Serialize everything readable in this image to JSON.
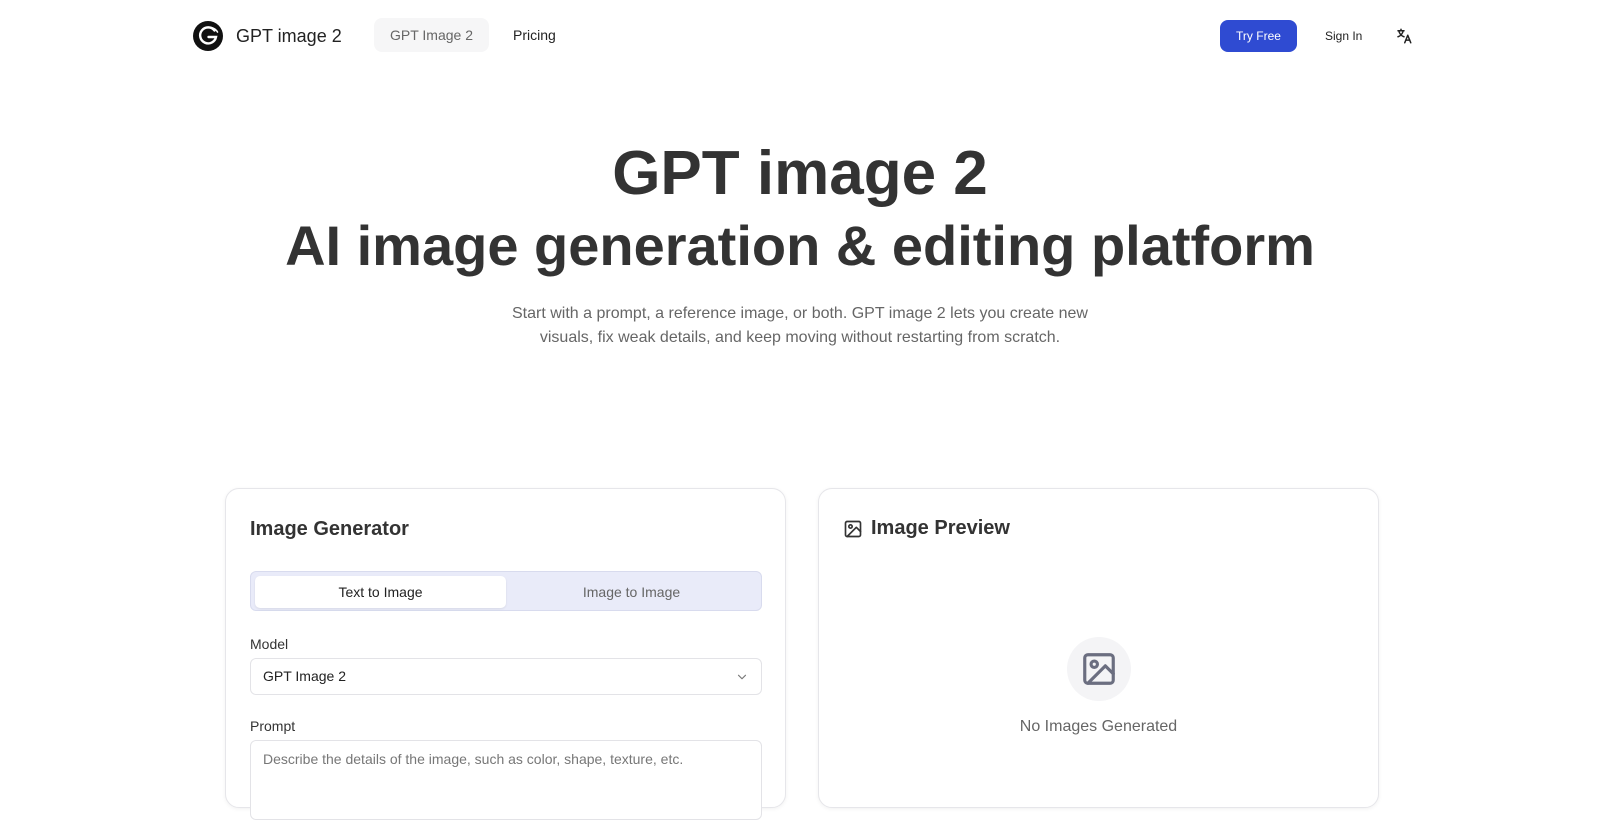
{
  "header": {
    "brand": "GPT image 2",
    "nav": [
      {
        "label": "GPT Image 2",
        "active": true
      },
      {
        "label": "Pricing",
        "active": false
      }
    ],
    "try_free": "Try Free",
    "sign_in": "Sign In",
    "language_icon": "translate-icon"
  },
  "hero": {
    "title": "GPT image 2",
    "subtitle": "AI image generation & editing platform",
    "description": "Start with a prompt, a reference image, or both. GPT image 2 lets you create new visuals, fix weak details, and keep moving without restarting from scratch."
  },
  "generator": {
    "title": "Image Generator",
    "tabs": [
      {
        "label": "Text to Image",
        "selected": true
      },
      {
        "label": "Image to Image",
        "selected": false
      }
    ],
    "model_label": "Model",
    "model_value": "GPT Image 2",
    "prompt_label": "Prompt",
    "prompt_placeholder": "Describe the details of the image, such as color, shape, texture, etc.",
    "prompt_value": ""
  },
  "preview": {
    "title": "Image Preview",
    "empty_text": "No Images Generated",
    "icon": "image-icon"
  },
  "colors": {
    "accent": "#2f4bd2",
    "tabs_bg": "#e9ebf9",
    "text_muted": "#666666"
  }
}
